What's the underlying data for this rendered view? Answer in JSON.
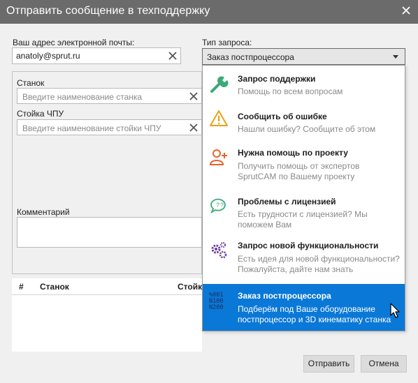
{
  "window": {
    "title": "Отправить сообщение в техподдержку"
  },
  "email": {
    "label": "Ваш адрес электронной почты:",
    "value": "anatoly@sprut.ru"
  },
  "request_type": {
    "label": "Тип запроса:",
    "selected": "Заказ постпроцессора"
  },
  "machine": {
    "label": "Станок",
    "placeholder": "Введите наименование станка"
  },
  "cnc": {
    "label": "Стойка ЧПУ",
    "placeholder": "Введите наименование стойки ЧПУ"
  },
  "comment": {
    "label": "Комментарий"
  },
  "table": {
    "columns": [
      "#",
      "Станок",
      "Стойк"
    ]
  },
  "dropdown": {
    "options": [
      {
        "title": "Запрос поддержки",
        "desc": "Помощь по всем вопросам",
        "icon": "wrench-icon"
      },
      {
        "title": "Сообщить об ошибке",
        "desc": "Нашли ошибку? Сообщите об этом",
        "icon": "warning-icon"
      },
      {
        "title": "Нужна помощь по проекту",
        "desc": "Получить помощь от экспертов SprutCAM по Вашему проекту",
        "icon": "add-user-icon"
      },
      {
        "title": "Проблемы с лицензией",
        "desc": "Есть трудности с лицензией? Мы поможем Вам",
        "icon": "chat-question-icon"
      },
      {
        "title": "Запрос новой функциональности",
        "desc": "Есть идея для новой функциональности? Пожалуйста, дайте нам знать",
        "icon": "gears-icon"
      },
      {
        "title": "Заказ постпроцессора",
        "desc": "Подберём под Ваше оборудование постпроцессор и 3D кинематику станка",
        "icon": "gcode-icon",
        "icon_text": [
          "%001",
          "N100",
          "N200"
        ]
      }
    ]
  },
  "buttons": {
    "send": "Отправить",
    "cancel": "Отмена"
  },
  "colors": {
    "titlebar": "#6b6b6b",
    "selection": "#0a78d7",
    "wrench": "#3aaa78",
    "warning": "#e8a317",
    "user": "#e8632c",
    "chat": "#3aaa78",
    "gears": "#6b3f9e"
  }
}
